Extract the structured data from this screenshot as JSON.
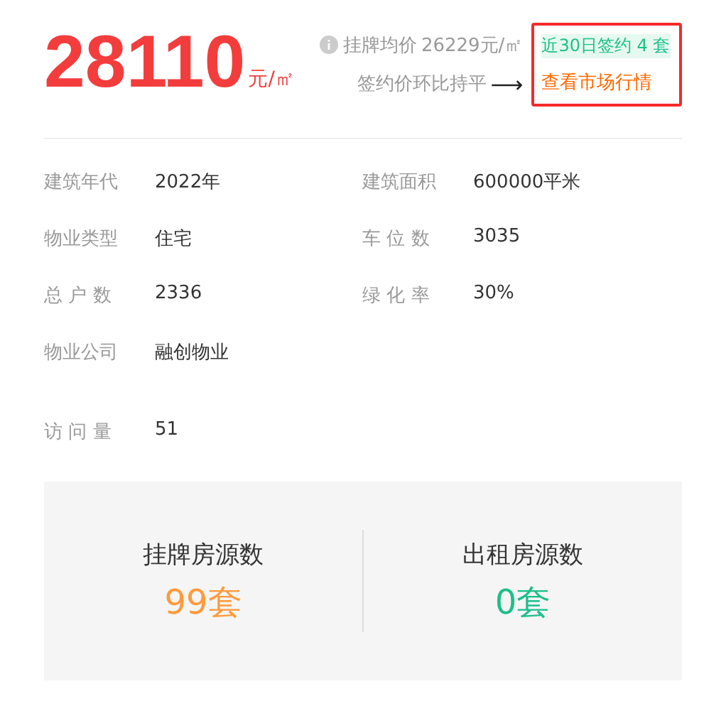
{
  "price": {
    "value": "28110",
    "unit": "元/㎡"
  },
  "listing": {
    "label": "挂牌均价",
    "value": "26229元/㎡",
    "trend": "签约价环比持平",
    "arrow": "⟶"
  },
  "highlight": {
    "signed": "近30日签约 4 套",
    "link": "查看市场行情"
  },
  "facts": [
    {
      "label": "建筑年代",
      "value": "2022年"
    },
    {
      "label": "建筑面积",
      "value": "600000平米"
    },
    {
      "label": "物业类型",
      "value": "住宅"
    },
    {
      "label": "车 位 数",
      "value": "3035"
    },
    {
      "label": "总 户 数",
      "value": "2336"
    },
    {
      "label": "绿 化 率",
      "value": "30%"
    },
    {
      "label": "物业公司",
      "value": "融创物业"
    }
  ],
  "visits": {
    "label": "访 问 量",
    "value": "51"
  },
  "stats": [
    {
      "label": "挂牌房源数",
      "value": "99套",
      "color": "#ff9a3c"
    },
    {
      "label": "出租房源数",
      "value": "0套",
      "color": "#1dbf8a"
    }
  ]
}
